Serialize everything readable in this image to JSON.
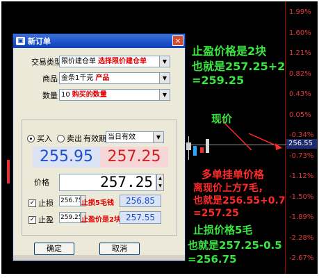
{
  "axis": {
    "labels": [
      "1.99%",
      "1.60%",
      "1.21%",
      "0.82%",
      "0.43%",
      "0.05%",
      "-0.34%",
      "-0.73%",
      "-1.12%",
      "-1.50%",
      "-1.89%",
      "-2.28%",
      "-2.67%"
    ],
    "current_price_tag": "256.55"
  },
  "dialog": {
    "title": "新订单",
    "close_glyph": "×",
    "order_type": {
      "label": "交易类型",
      "value": "限价建仓单",
      "note": "选择限价建仓单"
    },
    "product": {
      "label": "商品",
      "value": "金条1千克",
      "note": "产品"
    },
    "quantity": {
      "label": "数量",
      "value": "10",
      "note": "购买的数量"
    },
    "side": {
      "buy_label": "买入",
      "sell_label": "卖出"
    },
    "validity": {
      "label": "有效期",
      "value": "当日有效"
    },
    "buy_price": "255.95",
    "sell_price": "257.25",
    "price": {
      "label": "价格",
      "value": "257.25"
    },
    "stop_loss": {
      "label": "止损",
      "value": "256.75",
      "note": "止损5毛钱",
      "calc": "256.85"
    },
    "take_profit": {
      "label": "止盈",
      "value": "259.25",
      "note": "止盈价是2块",
      "calc": "257.55"
    },
    "ok_label": "确定",
    "cancel_label": "取消"
  },
  "annotations": {
    "long_order": "多单",
    "take_profit": [
      "止盈价格是2块",
      "也就是257.25+2",
      "=259.25"
    ],
    "current_price": "现价",
    "pending_order": [
      "多单挂单价格",
      "离现价上方7毛，",
      "也就是256.55+0.7",
      "=257.25"
    ],
    "stop_loss": [
      "止损价格5毛",
      "也就是257.25-0.5",
      "=256.75"
    ]
  },
  "colors": {
    "background": "#000000",
    "annotation_green": "#39e640",
    "annotation_red": "#ff2a2a",
    "axis_red": "#e83a3a"
  }
}
